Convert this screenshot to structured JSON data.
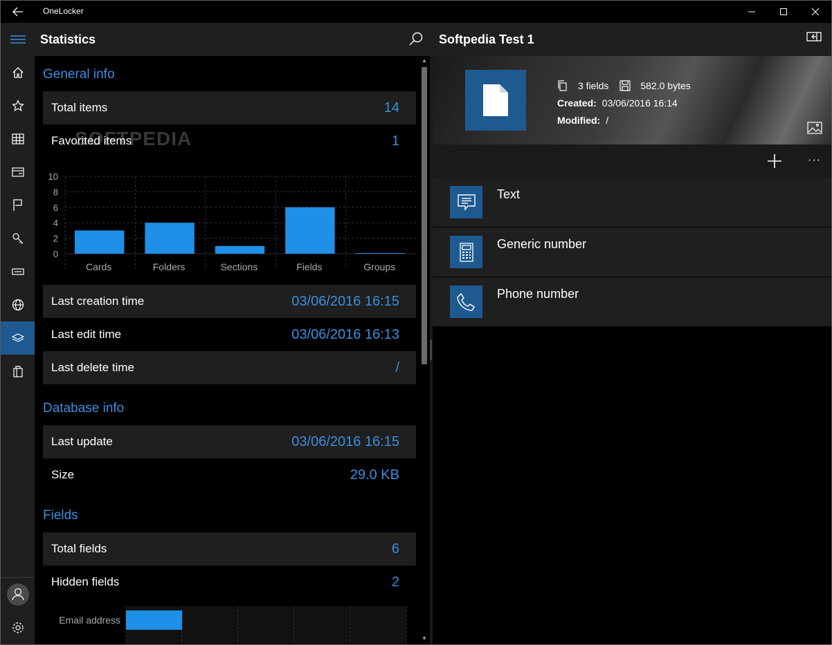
{
  "app": {
    "title": "OneLocker"
  },
  "nav": {
    "items": [
      "menu-icon",
      "home-icon",
      "star-icon",
      "grid-icon",
      "card-icon",
      "flag-icon",
      "key-icon",
      "device-icon",
      "globe-icon",
      "layers-icon",
      "bag-icon"
    ],
    "active": "layers-icon",
    "bottom": [
      "user-icon",
      "settings-icon"
    ]
  },
  "stats": {
    "header_title": "Statistics",
    "watermark": "SOFTPEDIA",
    "general_info_title": "General info",
    "total_items_label": "Total items",
    "total_items_value": "14",
    "favorited_items_label": "Favorited items",
    "favorited_items_value": "1",
    "last_creation_label": "Last creation time",
    "last_creation_value": "03/06/2016 16:15",
    "last_edit_label": "Last edit time",
    "last_edit_value": "03/06/2016 16:13",
    "last_delete_label": "Last delete time",
    "last_delete_value": "/",
    "database_info_title": "Database info",
    "last_update_label": "Last update",
    "last_update_value": "03/06/2016 16:15",
    "size_label": "Size",
    "size_value": "29.0 KB",
    "fields_title": "Fields",
    "total_fields_label": "Total fields",
    "total_fields_value": "6",
    "hidden_fields_label": "Hidden fields",
    "hidden_fields_value": "2"
  },
  "chart_data": [
    {
      "type": "bar",
      "categories": [
        "Cards",
        "Folders",
        "Sections",
        "Fields",
        "Groups"
      ],
      "values": [
        3,
        4,
        1,
        6,
        0
      ],
      "ylim": [
        0,
        10
      ],
      "yticks": [
        0,
        2,
        4,
        6,
        8,
        10
      ],
      "grid": true,
      "bar_color": "#1e90e8"
    },
    {
      "type": "bar",
      "orientation": "horizontal",
      "categories": [
        "Email address"
      ],
      "values": [
        1
      ],
      "xlim": [
        0,
        5
      ],
      "bar_color": "#1e90e8"
    }
  ],
  "detail": {
    "header_title": "Softpedia Test 1",
    "fields_count": "3 fields",
    "size": "582.0 bytes",
    "created_label": "Created:",
    "created_value": "03/06/2016 16:14",
    "modified_label": "Modified:",
    "modified_value": "/",
    "more_label": "···",
    "fields": [
      {
        "name": "Text",
        "icon": "message-icon"
      },
      {
        "name": "Generic number",
        "icon": "calculator-icon"
      },
      {
        "name": "Phone number",
        "icon": "phone-icon"
      }
    ]
  },
  "colors": {
    "accent": "#3b8ede",
    "tile": "#1e5a8f",
    "bar": "#1e90e8",
    "panel": "#1f1f1f"
  }
}
